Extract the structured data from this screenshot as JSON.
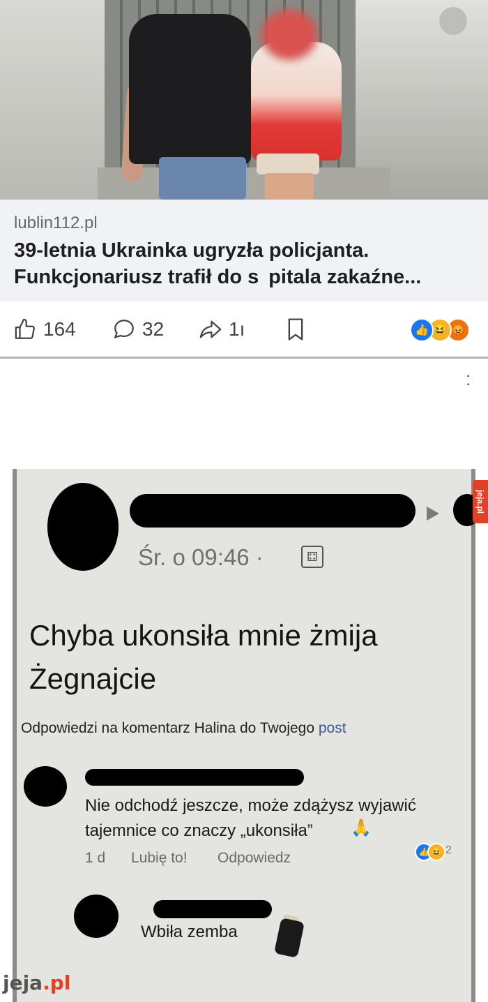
{
  "link_card": {
    "domain": "lublin112.pl",
    "headline": "39-letnia Ukrainka ugryzła policjanta. Funkcjonariusz trafił do s  pitala zakaźne..."
  },
  "actions": {
    "likes": "164",
    "comments": "32",
    "shares": "1ı",
    "icons": [
      "thumbs-up-icon",
      "comment-icon",
      "share-icon",
      "bookmark-icon"
    ]
  },
  "comment_screenshot": {
    "timestamp": "Śr. o 09:46 ·",
    "post_text_line1": "Chyba ukonsiła mnie żmija",
    "post_text_line2": "Żegnajcie",
    "replies_header": "Odpowiedzi na komentarz Halina do Twojego",
    "replies_header_link": "post",
    "reply1": {
      "text": "Nie odchodź jeszcze, może zdążysz wyjawić tajemnice co znaczy „ukonsiła”",
      "age": "1 d",
      "like": "Lubię to!",
      "respond": "Odpowiedz",
      "reaction_count": "2"
    },
    "reply2": {
      "text": "Wbiła zemba"
    }
  },
  "branding": {
    "side_badge": "jeja.pl",
    "watermark_main": "jeja",
    "watermark_tld": ".pl",
    "accent": "#e04225"
  }
}
